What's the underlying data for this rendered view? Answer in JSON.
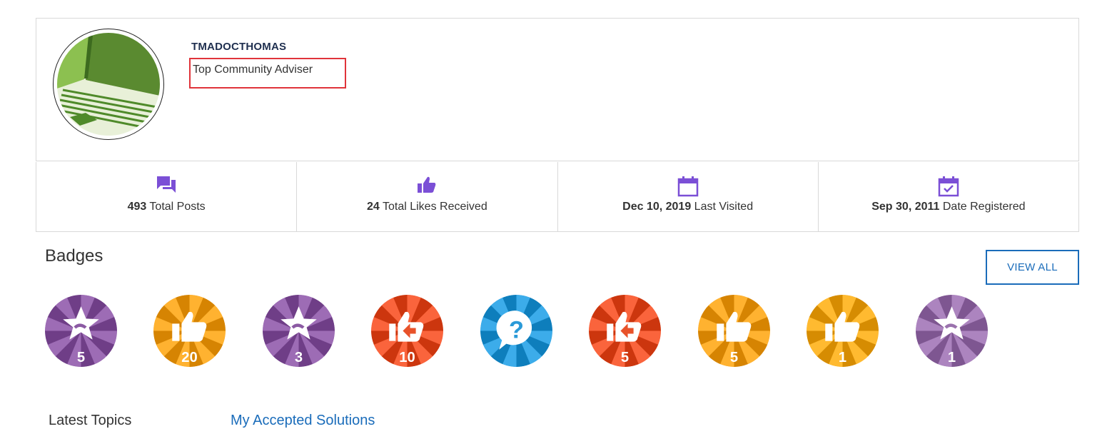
{
  "profile": {
    "username": "TMADOCTHOMAS",
    "rank": "Top Community Adviser"
  },
  "stats": [
    {
      "icon": "chat-bubbles-icon",
      "value": "493",
      "label": "Total Posts"
    },
    {
      "icon": "thumbs-up-icon",
      "value": "24",
      "label": "Total Likes Received"
    },
    {
      "icon": "calendar-icon",
      "value": "Dec 10, 2019",
      "label": "Last Visited"
    },
    {
      "icon": "calendar-check-icon",
      "value": "Sep 30, 2011",
      "label": "Date Registered"
    }
  ],
  "badges_section": {
    "title": "Badges",
    "view_all_label": "VIEW ALL",
    "items": [
      {
        "icon": "solution-star-icon",
        "count": "5",
        "color": "#8b5aa3"
      },
      {
        "icon": "thumbs-up-icon",
        "count": "20",
        "color": "#f2a01e"
      },
      {
        "icon": "solution-star-icon",
        "count": "3",
        "color": "#8b5aa3"
      },
      {
        "icon": "thumbs-up-arrow-icon",
        "count": "10",
        "color": "#e8522a"
      },
      {
        "icon": "question-icon",
        "count": "",
        "color": "#2a9ad8"
      },
      {
        "icon": "thumbs-up-arrow-icon",
        "count": "5",
        "color": "#e8522a"
      },
      {
        "icon": "thumbs-up-icon",
        "count": "5",
        "color": "#f2a01e"
      },
      {
        "icon": "thumbs-up-icon",
        "count": "1",
        "color": "#f2a81e"
      },
      {
        "icon": "solution-star-icon",
        "count": "1",
        "color": "#9a72ad"
      }
    ]
  },
  "tabs": {
    "latest_topics": "Latest Topics",
    "accepted_solutions": "My Accepted Solutions"
  },
  "colors": {
    "accent_purple": "#7b4fd6",
    "link_blue": "#1a6cba",
    "highlight_red": "#e0343a"
  }
}
